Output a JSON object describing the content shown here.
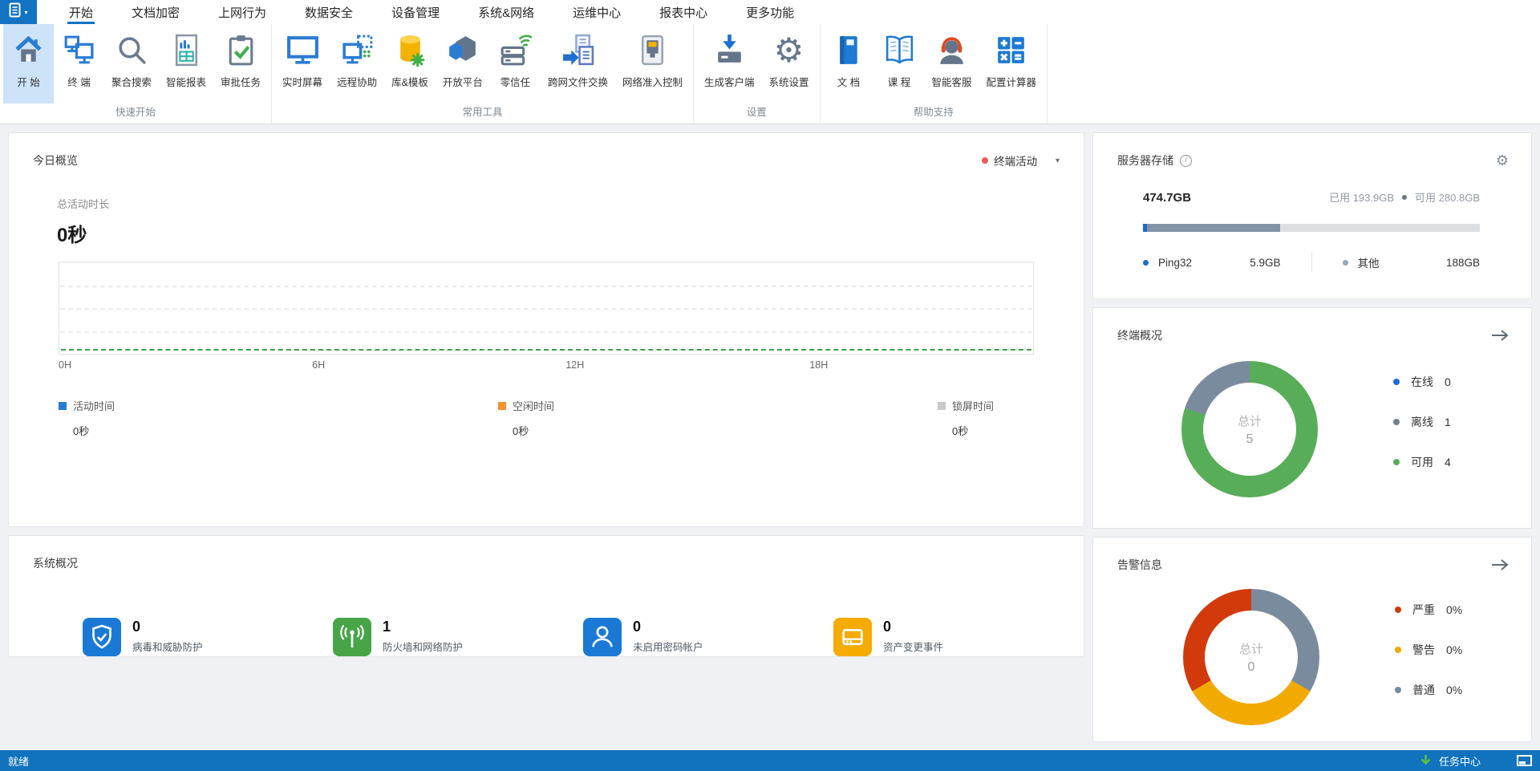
{
  "colors": {
    "accent_blue": "#1173c2",
    "ribbon_highlight": "#cde3f7",
    "statusbar_blue": "#1173bd",
    "chart_green_line": "#3fa24c"
  },
  "tabs": [
    {
      "label": "开始",
      "active": true
    },
    {
      "label": "文档加密",
      "active": false
    },
    {
      "label": "上网行为",
      "active": false
    },
    {
      "label": "数据安全",
      "active": false
    },
    {
      "label": "设备管理",
      "active": false
    },
    {
      "label": "系统&网络",
      "active": false
    },
    {
      "label": "运维中心",
      "active": false
    },
    {
      "label": "报表中心",
      "active": false
    },
    {
      "label": "更多功能",
      "active": false
    }
  ],
  "ribbon": {
    "groups": [
      {
        "label": "快速开始",
        "items": [
          {
            "label": "开 始",
            "icon": "home-icon",
            "active": true
          },
          {
            "label": "终 端",
            "icon": "terminal-icon"
          },
          {
            "label": "聚合搜索",
            "icon": "search-icon"
          },
          {
            "label": "智能报表",
            "icon": "smart-report-icon"
          },
          {
            "label": "审批任务",
            "icon": "approval-task-icon"
          }
        ]
      },
      {
        "label": "常用工具",
        "items": [
          {
            "label": "实时屏幕",
            "icon": "live-screen-icon"
          },
          {
            "label": "远程协助",
            "icon": "remote-assist-icon"
          },
          {
            "label": "库&模板",
            "icon": "library-template-icon"
          },
          {
            "label": "开放平台",
            "icon": "open-platform-icon"
          },
          {
            "label": "零信任",
            "icon": "zero-trust-icon"
          },
          {
            "label": "跨网文件交换",
            "icon": "file-exchange-icon"
          },
          {
            "label": "网络准入控制",
            "icon": "network-access-icon"
          }
        ]
      },
      {
        "label": "设置",
        "items": [
          {
            "label": "生成客户端",
            "icon": "generate-client-icon"
          },
          {
            "label": "系统设置",
            "icon": "system-settings-icon"
          }
        ]
      },
      {
        "label": "帮助支持",
        "items": [
          {
            "label": "文 档",
            "icon": "docs-icon"
          },
          {
            "label": "课 程",
            "icon": "course-icon"
          },
          {
            "label": "智能客服",
            "icon": "smart-support-icon"
          },
          {
            "label": "配置计算器",
            "icon": "config-calculator-icon"
          }
        ]
      }
    ]
  },
  "today": {
    "title": "今日概览",
    "filter": {
      "label": "终端活动",
      "dot_color": "#f05a5a",
      "caret": "▼"
    },
    "metric": {
      "label": "总活动时长",
      "value": "0秒"
    },
    "chart": {
      "type": "area",
      "x_ticks": [
        "0H",
        "6H",
        "12H",
        "18H"
      ],
      "series_values": [
        0,
        0,
        0
      ]
    },
    "legend": [
      {
        "label": "活动时间",
        "value": "0秒",
        "color": "#2a7ad6"
      },
      {
        "label": "空闲时间",
        "value": "0秒",
        "color": "#f0922e"
      },
      {
        "label": "锁屏时间",
        "value": "0秒",
        "color": "#c6c8ca"
      }
    ]
  },
  "storage": {
    "title": "服务器存储",
    "total": "474.7GB",
    "used_label": "已用",
    "used_value": "193.9GB",
    "free_label": "可用",
    "free_value": "280.8GB",
    "bar": {
      "track": "#dcdfe2",
      "segments": [
        {
          "color": "#1b6cc8",
          "pct": 1.3
        },
        {
          "color": "#8493a6",
          "pct": 39.5
        }
      ]
    },
    "legend": [
      {
        "label": "Ping32",
        "value": "5.9GB",
        "color": "#1b6cc8"
      },
      {
        "label": "其他",
        "value": "188GB",
        "color": "#9aa7b4"
      }
    ]
  },
  "terminal": {
    "title": "终端概况",
    "center_label": "总计",
    "center_value": "5",
    "donut": {
      "segments": [
        {
          "name": "可用",
          "color": "#58ad58",
          "deg": 288
        },
        {
          "name": "离线",
          "color": "#7b8b9e",
          "deg": 72
        }
      ]
    },
    "legend": [
      {
        "label": "在线",
        "value": "0",
        "color": "#1a6fd4"
      },
      {
        "label": "离线",
        "value": "1",
        "color": "#6e7f93"
      },
      {
        "label": "可用",
        "value": "4",
        "color": "#58ad58"
      }
    ]
  },
  "system": {
    "title": "系统概况",
    "items": [
      {
        "value": "0",
        "label": "病毒和威胁防护",
        "icon": "shield-check-icon",
        "color": "#1b79d6"
      },
      {
        "value": "1",
        "label": "防火墙和网络防护",
        "icon": "antenna-icon",
        "color": "#47a447"
      },
      {
        "value": "0",
        "label": "未启用密码帐户",
        "icon": "account-icon",
        "color": "#1b79d6"
      },
      {
        "value": "0",
        "label": "资产变更事件",
        "icon": "asset-drive-icon",
        "color": "#f5ab00"
      }
    ]
  },
  "alarm": {
    "title": "告警信息",
    "center_label": "总计",
    "center_value": "0",
    "donut": {
      "segments": [
        {
          "name": "普通",
          "color": "#7b8b9e",
          "deg": 120
        },
        {
          "name": "警告",
          "color": "#f2aa00",
          "deg": 120
        },
        {
          "name": "严重",
          "color": "#d23a0c",
          "deg": 120
        }
      ]
    },
    "legend": [
      {
        "label": "严重",
        "value": "0%",
        "color": "#d23a0c"
      },
      {
        "label": "警告",
        "value": "0%",
        "color": "#f2aa00"
      },
      {
        "label": "普通",
        "value": "0%",
        "color": "#7b8b9e"
      }
    ]
  },
  "statusbar": {
    "status": "就绪",
    "task_center": "任务中心"
  }
}
